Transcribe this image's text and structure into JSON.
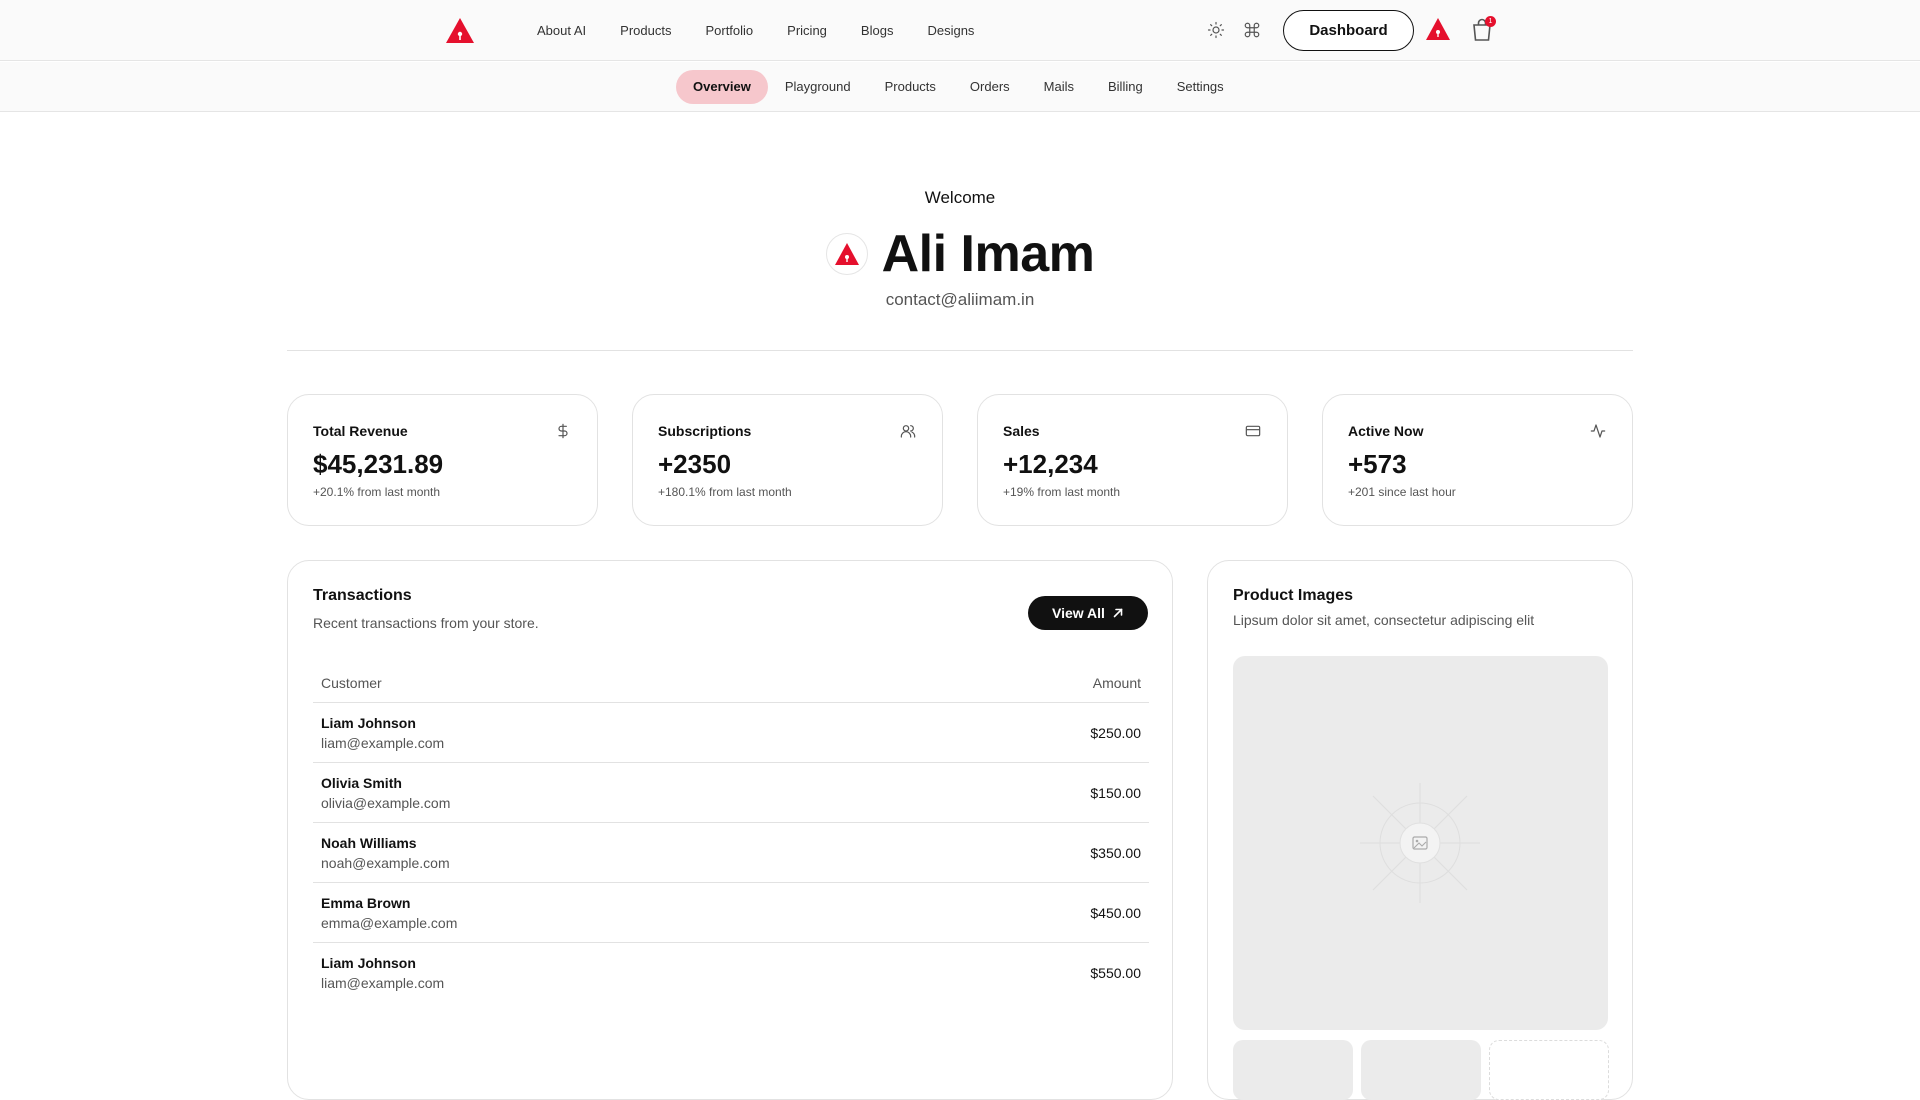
{
  "header": {
    "logo": "brand-logo-triangle",
    "nav_links": [
      "About AI",
      "Products",
      "Portfolio",
      "Pricing",
      "Blogs",
      "Designs"
    ],
    "dashboard_label": "Dashboard",
    "cart_count": "1"
  },
  "subnav": {
    "tabs": [
      "Overview",
      "Playground",
      "Products",
      "Orders",
      "Mails",
      "Billing",
      "Settings"
    ],
    "active": "Overview"
  },
  "welcome": {
    "greeting": "Welcome",
    "name": "Ali Imam",
    "email": "contact@aliimam.in"
  },
  "stats": [
    {
      "title": "Total Revenue",
      "value": "$45,231.89",
      "sub": "+20.1% from last month",
      "icon": "dollar-icon"
    },
    {
      "title": "Subscriptions",
      "value": "+2350",
      "sub": "+180.1% from last month",
      "icon": "users-icon"
    },
    {
      "title": "Sales",
      "value": "+12,234",
      "sub": "+19% from last month",
      "icon": "credit-card-icon"
    },
    {
      "title": "Active Now",
      "value": "+573",
      "sub": "+201 since last hour",
      "icon": "activity-icon"
    }
  ],
  "transactions": {
    "title": "Transactions",
    "description": "Recent transactions from your store.",
    "view_all": "View All",
    "columns": [
      "Customer",
      "Amount"
    ],
    "rows": [
      {
        "name": "Liam Johnson",
        "email": "liam@example.com",
        "amount": "$250.00"
      },
      {
        "name": "Olivia Smith",
        "email": "olivia@example.com",
        "amount": "$150.00"
      },
      {
        "name": "Noah Williams",
        "email": "noah@example.com",
        "amount": "$350.00"
      },
      {
        "name": "Emma Brown",
        "email": "emma@example.com",
        "amount": "$450.00"
      },
      {
        "name": "Liam Johnson",
        "email": "liam@example.com",
        "amount": "$550.00"
      }
    ]
  },
  "product_images": {
    "title": "Product Images",
    "description": "Lipsum dolor sit amet, consectetur adipiscing elit"
  },
  "colors": {
    "brand_red": "#e5102d",
    "active_tab_bg": "#f6c7cc",
    "dark": "#111111",
    "muted_text": "#555555",
    "border": "#e2e2e2",
    "placeholder_bg": "#ebebeb"
  }
}
